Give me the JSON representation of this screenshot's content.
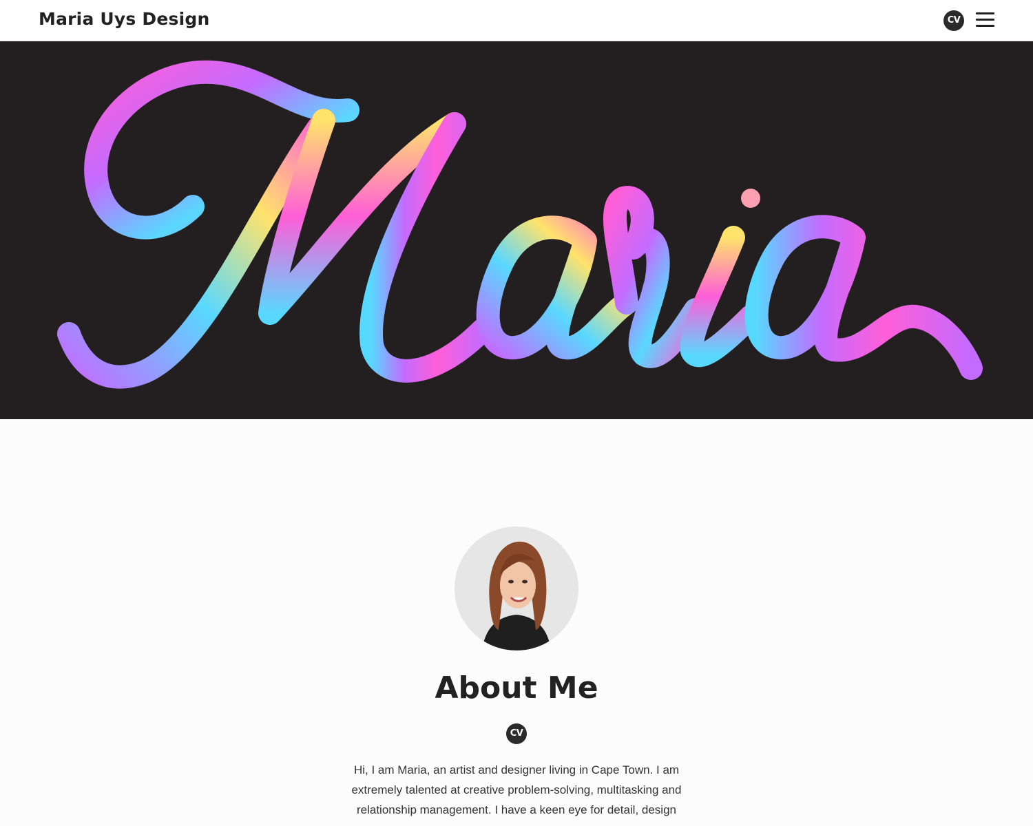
{
  "header": {
    "brand": "Maria Uys Design",
    "cv_label": "CV",
    "menu_icon": "hamburger-menu-icon"
  },
  "hero": {
    "lettering": "Maria",
    "background_color": "#231f20",
    "gradient_colors": [
      "#ff5ed8",
      "#c46bff",
      "#59d8ff",
      "#ffe36b",
      "#ff9bb0"
    ]
  },
  "about": {
    "title": "About Me",
    "cv_label": "CV",
    "paragraph": "Hi, I am Maria, an artist and designer living in Cape Town.  I am extremely talented at creative problem-solving, multitasking and relationship management.  I have a keen eye for detail, design"
  }
}
